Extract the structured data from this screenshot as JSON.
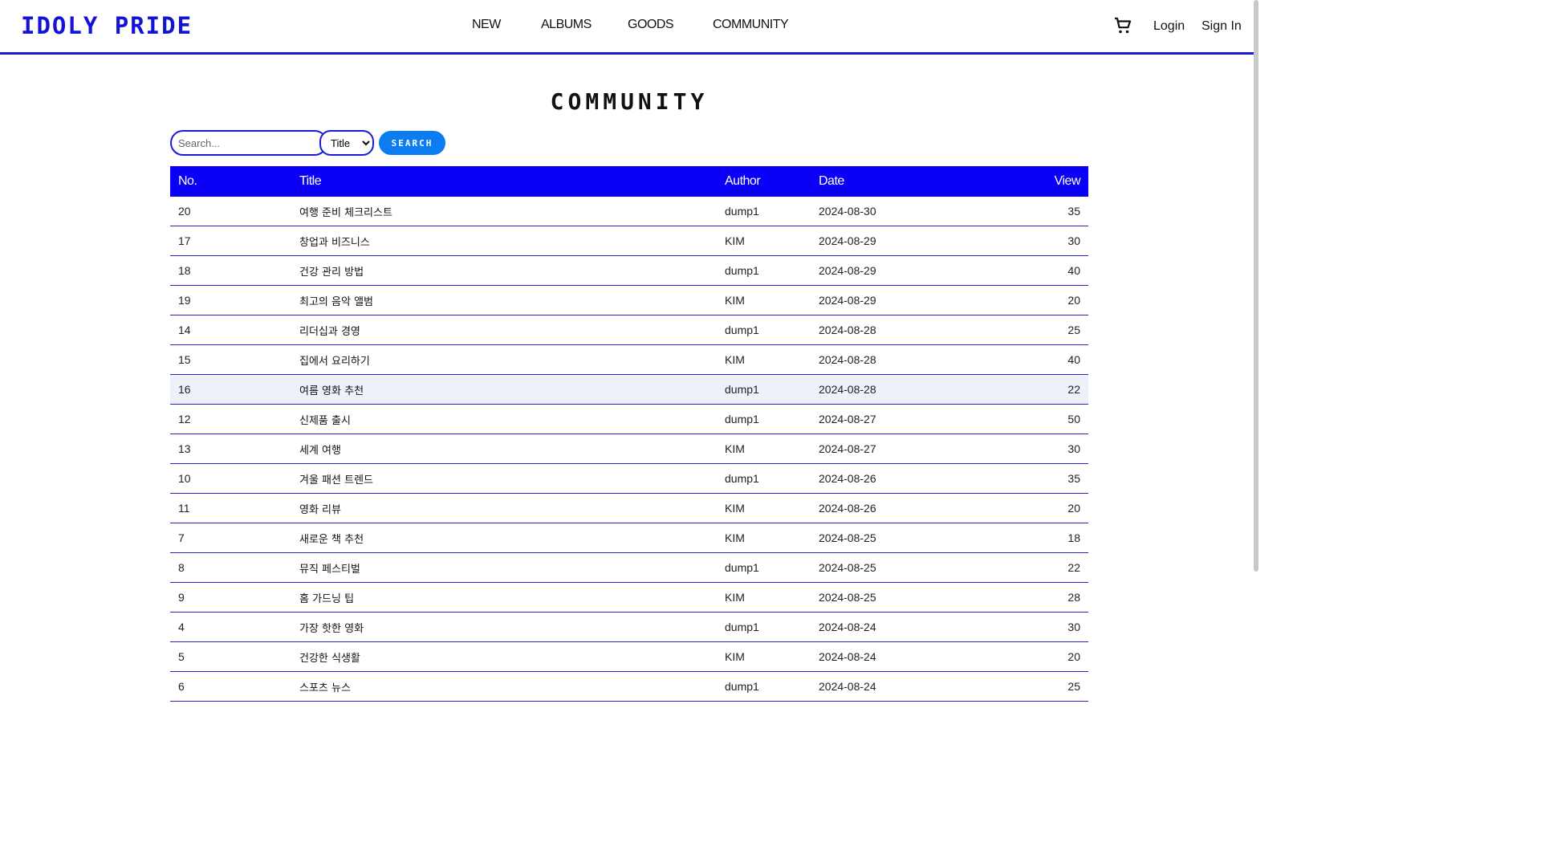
{
  "header": {
    "logo": "IDOLY PRIDE",
    "nav": [
      "NEW",
      "ALBUMS",
      "GOODS",
      "COMMUNITY"
    ],
    "cart_icon": "cart-icon",
    "login": "Login",
    "signin": "Sign In"
  },
  "page": {
    "title": "COMMUNITY"
  },
  "search": {
    "placeholder": "Search...",
    "filter_selected": "Title",
    "button": "SEARCH"
  },
  "table": {
    "headers": [
      "No.",
      "Title",
      "Author",
      "Date",
      "View"
    ],
    "rows": [
      {
        "no": "20",
        "title": "여행 준비 체크리스트",
        "author": "dump1",
        "date": "2024-08-30",
        "view": "35"
      },
      {
        "no": "17",
        "title": "창업과 비즈니스",
        "author": "KIM",
        "date": "2024-08-29",
        "view": "30"
      },
      {
        "no": "18",
        "title": "건강 관리 방법",
        "author": "dump1",
        "date": "2024-08-29",
        "view": "40"
      },
      {
        "no": "19",
        "title": "최고의 음악 앨범",
        "author": "KIM",
        "date": "2024-08-29",
        "view": "20"
      },
      {
        "no": "14",
        "title": "리더십과 경영",
        "author": "dump1",
        "date": "2024-08-28",
        "view": "25"
      },
      {
        "no": "15",
        "title": "집에서 요리하기",
        "author": "KIM",
        "date": "2024-08-28",
        "view": "40"
      },
      {
        "no": "16",
        "title": "여름 영화 추천",
        "author": "dump1",
        "date": "2024-08-28",
        "view": "22"
      },
      {
        "no": "12",
        "title": "신제품 출시",
        "author": "dump1",
        "date": "2024-08-27",
        "view": "50"
      },
      {
        "no": "13",
        "title": "세계 여행",
        "author": "KIM",
        "date": "2024-08-27",
        "view": "30"
      },
      {
        "no": "10",
        "title": "겨울 패션 트렌드",
        "author": "dump1",
        "date": "2024-08-26",
        "view": "35"
      },
      {
        "no": "11",
        "title": "영화 리뷰",
        "author": "KIM",
        "date": "2024-08-26",
        "view": "20"
      },
      {
        "no": "7",
        "title": "새로운 책 추천",
        "author": "KIM",
        "date": "2024-08-25",
        "view": "18"
      },
      {
        "no": "8",
        "title": "뮤직 페스티벌",
        "author": "dump1",
        "date": "2024-08-25",
        "view": "22"
      },
      {
        "no": "9",
        "title": "홈 가드닝 팁",
        "author": "KIM",
        "date": "2024-08-25",
        "view": "28"
      },
      {
        "no": "4",
        "title": "가장 핫한 영화",
        "author": "dump1",
        "date": "2024-08-24",
        "view": "30"
      },
      {
        "no": "5",
        "title": "건강한 식생활",
        "author": "KIM",
        "date": "2024-08-24",
        "view": "20"
      },
      {
        "no": "6",
        "title": "스포츠 뉴스",
        "author": "dump1",
        "date": "2024-08-24",
        "view": "25"
      }
    ]
  }
}
